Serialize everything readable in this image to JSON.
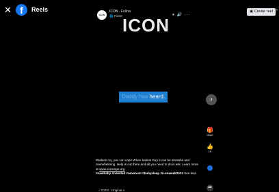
{
  "topbar": {
    "close_glyph": "✕",
    "logo_glyph": "f",
    "title": "Reels"
  },
  "video": {
    "channel_avatar_text": "ICON",
    "channel_name": "ICON",
    "follow_label": "Follow",
    "audience": "Public",
    "controls": "⏸ 🔊 ···",
    "logo_text": "ICON",
    "caption_dim": "Daddy has",
    "caption_bright": "heard."
  },
  "description": {
    "text": "#babies cry, you can cope When babies #cry it can be stressful and overwhelming. Help is out there and all you need to do is ask. Learn more at ",
    "link": "www.iconcope.org",
    "hashtags": "#newbaby #newdad #newmum #babysleep #iconweek2023",
    "see_less": "See less",
    "audio": "ICON · Original a"
  },
  "actions": {
    "next_glyph": "›",
    "give_label": "Give!",
    "like_count": "15"
  },
  "header_right": {
    "create_reel_label": "Create reel",
    "overflow": "‹"
  },
  "colors": {
    "caption_bg": "#1f7fd0",
    "brand": "#1877f2"
  }
}
